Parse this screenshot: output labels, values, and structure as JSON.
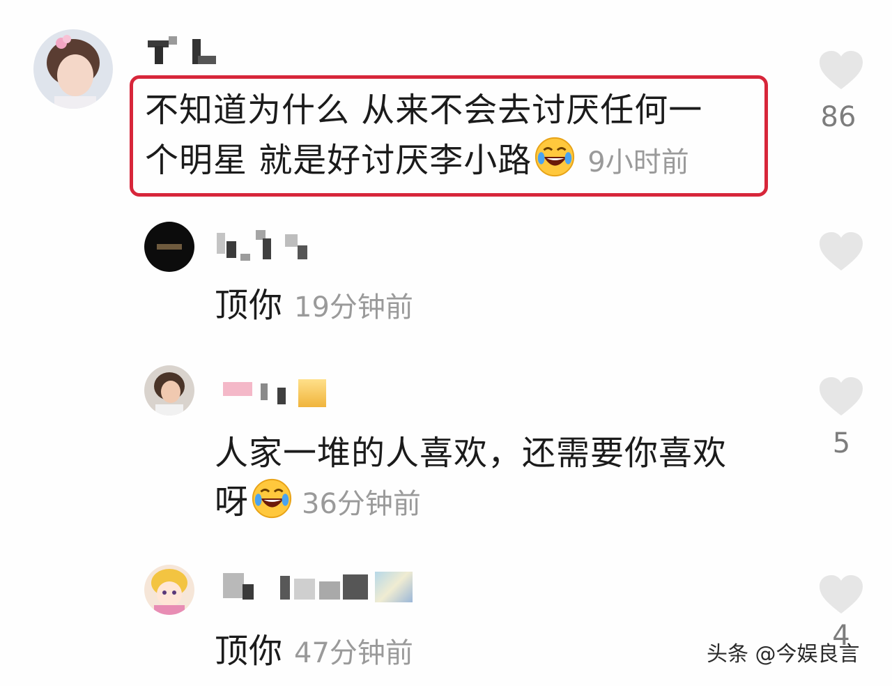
{
  "comments": [
    {
      "text_line1": "不知道为什么 从来不会去讨厌任何一",
      "text_line2": "个明星 就是好讨厌李小路",
      "time": "9小时前",
      "likes": "86",
      "emoji": "rofl-emoji"
    },
    {
      "text_line1": "顶你",
      "time": "19分钟前",
      "likes": ""
    },
    {
      "text_line1": "人家一堆的人喜欢，还需要你喜欢",
      "text_line2": "呀",
      "time": "36分钟前",
      "likes": "5",
      "emoji": "rofl-emoji"
    },
    {
      "text_line1": "顶你",
      "time": "47分钟前",
      "likes": "4"
    }
  ],
  "watermark": "头条 @今娱良言",
  "colors": {
    "highlight_border": "#d7263a",
    "text": "#1b1b1b",
    "time": "#9a9a9a",
    "like_icon": "#e6e6e6"
  }
}
